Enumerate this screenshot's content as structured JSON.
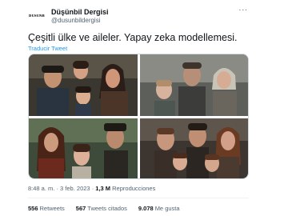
{
  "author": {
    "avatar_text": "ᴅᴜsᴜɴʙ",
    "name": "Düşünbil Dergisi",
    "handle": "@dusunbildergisi"
  },
  "tweet": {
    "text": "Çeşitli ülke ve aileler. Yapay zeka modellemesi.",
    "translate_label": "Traducir Tweet"
  },
  "media": {
    "images": [
      {
        "alt": "family portrait 1"
      },
      {
        "alt": "family portrait 2"
      },
      {
        "alt": "family portrait 3"
      },
      {
        "alt": "family portrait 4"
      }
    ]
  },
  "meta": {
    "time": "8:48 a. m.",
    "separator": "·",
    "date": "3 feb. 2023",
    "views_count": "1,3 M",
    "views_label": "Reproducciones"
  },
  "stats": [
    {
      "count": "556",
      "label": "Retweets"
    },
    {
      "count": "567",
      "label": "Tweets citados"
    },
    {
      "count": "9.078",
      "label": "Me gusta"
    }
  ]
}
